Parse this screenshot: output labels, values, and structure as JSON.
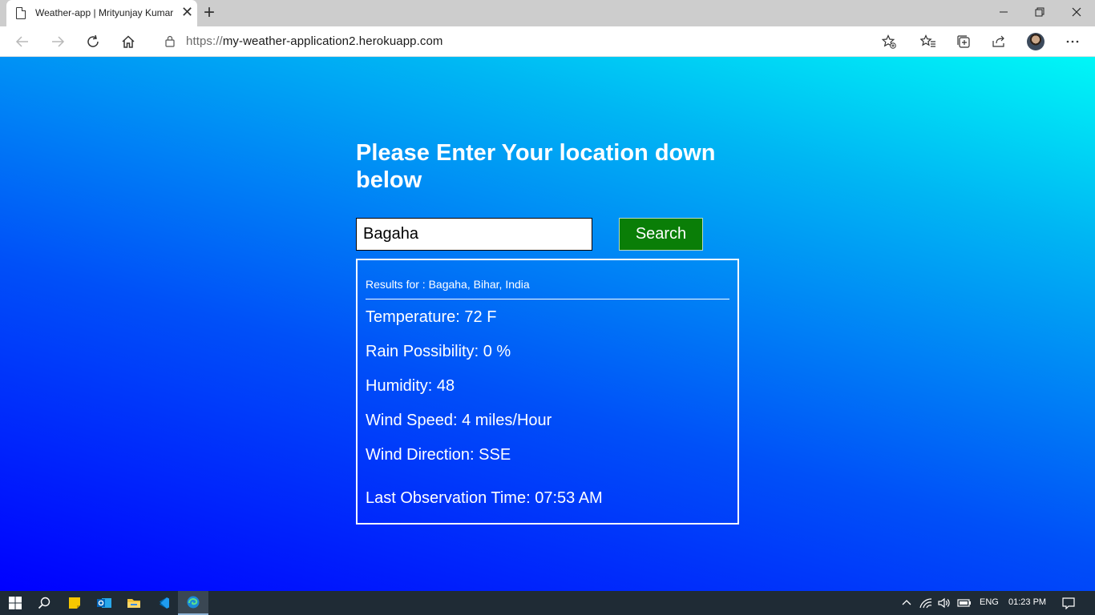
{
  "browser": {
    "tab_title": "Weather-app | Mrityunjay Kumar",
    "url_scheme": "https://",
    "url_host": "my-weather-application2.herokuapp.com"
  },
  "page": {
    "heading": "Please Enter Your location down below",
    "search_value": "Bagaha",
    "search_button": "Search",
    "results": {
      "results_for": "Results for : Bagaha, Bihar, India",
      "temperature": "Temperature: 72 F",
      "rain": "Rain Possibility: 0 %",
      "humidity": "Humidity: 48",
      "wind_speed": "Wind Speed: 4 miles/Hour",
      "wind_direction": "Wind Direction: SSE",
      "last_observation": "Last Observation Time: 07:53 AM"
    }
  },
  "taskbar": {
    "language": "ENG",
    "time": "01:23 PM"
  },
  "colors": {
    "search_button": "#0a7e07",
    "gradient_start": "#0000ff",
    "gradient_end": "#00f7f7"
  }
}
